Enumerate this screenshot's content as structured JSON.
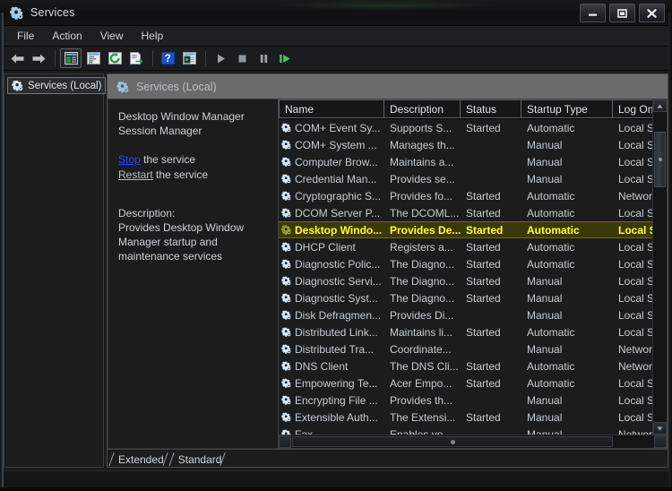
{
  "window": {
    "title": "Services",
    "title_icon": "services-gear-icon",
    "controls": {
      "minimize": "minimize-button",
      "maximize": "maximize-button",
      "close": "close-button"
    }
  },
  "menubar": {
    "items": [
      {
        "label": "File"
      },
      {
        "label": "Action"
      },
      {
        "label": "View"
      },
      {
        "label": "Help"
      }
    ]
  },
  "toolbar": {
    "items": [
      {
        "name": "back-icon"
      },
      {
        "name": "forward-icon"
      },
      {
        "name": "separator"
      },
      {
        "name": "show-hide-console-tree-icon"
      },
      {
        "name": "properties-icon"
      },
      {
        "name": "refresh-icon"
      },
      {
        "name": "export-list-icon"
      },
      {
        "name": "separator"
      },
      {
        "name": "help-icon"
      },
      {
        "name": "show-hide-action-pane-icon"
      },
      {
        "name": "separator"
      },
      {
        "name": "start-service-icon"
      },
      {
        "name": "stop-service-icon"
      },
      {
        "name": "pause-service-icon"
      },
      {
        "name": "restart-service-icon"
      }
    ]
  },
  "tree": {
    "root": {
      "label": "Services (Local)",
      "icon": "services-gear-icon",
      "selected": true
    }
  },
  "pane": {
    "header": {
      "label": "Services (Local)",
      "icon": "services-gear-icon"
    }
  },
  "details": {
    "service_name_line1": "Desktop Window Manager",
    "service_name_line2": "Session Manager",
    "actions": [
      {
        "link": "Stop",
        "suffix": " the service",
        "style": "primary"
      },
      {
        "link": "Restart",
        "suffix": " the service",
        "style": "secondary"
      }
    ],
    "description_label": "Description:",
    "description_lines": [
      "Provides Desktop Window",
      "Manager startup and",
      "maintenance services"
    ]
  },
  "list": {
    "columns": [
      {
        "label": "Name"
      },
      {
        "label": "Description"
      },
      {
        "label": "Status"
      },
      {
        "label": "Startup Type"
      },
      {
        "label": "Log On A"
      }
    ],
    "rows": [
      {
        "name": "COM+ Event Sy...",
        "description": "Supports S...",
        "status": "Started",
        "startup": "Automatic",
        "logon": "Local Ser",
        "selected": false
      },
      {
        "name": "COM+ System ...",
        "description": "Manages th...",
        "status": "",
        "startup": "Manual",
        "logon": "Local Sys",
        "selected": false
      },
      {
        "name": "Computer Brow...",
        "description": "Maintains a...",
        "status": "",
        "startup": "Manual",
        "logon": "Local Sys",
        "selected": false
      },
      {
        "name": "Credential Man...",
        "description": "Provides se...",
        "status": "",
        "startup": "Manual",
        "logon": "Local Sys",
        "selected": false
      },
      {
        "name": "Cryptographic S...",
        "description": "Provides fo...",
        "status": "Started",
        "startup": "Automatic",
        "logon": "Network",
        "selected": false
      },
      {
        "name": "DCOM Server P...",
        "description": "The DCOML...",
        "status": "Started",
        "startup": "Automatic",
        "logon": "Local Sys",
        "selected": false
      },
      {
        "name": "Desktop Windo...",
        "description": "Provides De...",
        "status": "Started",
        "startup": "Automatic",
        "logon": "Local Sys",
        "selected": true
      },
      {
        "name": "DHCP Client",
        "description": "Registers a...",
        "status": "Started",
        "startup": "Automatic",
        "logon": "Local Ser",
        "selected": false
      },
      {
        "name": "Diagnostic Polic...",
        "description": "The Diagno...",
        "status": "Started",
        "startup": "Automatic",
        "logon": "Local Ser",
        "selected": false
      },
      {
        "name": "Diagnostic Servi...",
        "description": "The Diagno...",
        "status": "Started",
        "startup": "Manual",
        "logon": "Local Ser",
        "selected": false
      },
      {
        "name": "Diagnostic Syst...",
        "description": "The Diagno...",
        "status": "Started",
        "startup": "Manual",
        "logon": "Local Sys",
        "selected": false
      },
      {
        "name": "Disk Defragmen...",
        "description": "Provides Di...",
        "status": "",
        "startup": "Manual",
        "logon": "Local Sys",
        "selected": false
      },
      {
        "name": "Distributed Link...",
        "description": "Maintains li...",
        "status": "Started",
        "startup": "Automatic",
        "logon": "Local Sys",
        "selected": false
      },
      {
        "name": "Distributed Tra...",
        "description": "Coordinate...",
        "status": "",
        "startup": "Manual",
        "logon": "Network",
        "selected": false
      },
      {
        "name": "DNS Client",
        "description": "The DNS Cli...",
        "status": "Started",
        "startup": "Automatic",
        "logon": "Network",
        "selected": false
      },
      {
        "name": "Empowering Te...",
        "description": "Acer Empo...",
        "status": "Started",
        "startup": "Automatic",
        "logon": "Local Sys",
        "selected": false
      },
      {
        "name": "Encrypting File ...",
        "description": "Provides th...",
        "status": "",
        "startup": "Manual",
        "logon": "Local Sys",
        "selected": false
      },
      {
        "name": "Extensible Auth...",
        "description": "The Extensi...",
        "status": "Started",
        "startup": "Manual",
        "logon": "Local Sys",
        "selected": false
      },
      {
        "name": "Fax",
        "description": "Enables yo",
        "status": "",
        "startup": "Manual",
        "logon": "Network",
        "selected": false
      }
    ]
  },
  "tabs": {
    "items": [
      {
        "label": "Extended",
        "active": false
      },
      {
        "label": "Standard",
        "active": true
      }
    ]
  },
  "colors": {
    "selection_text": "#ffff2e",
    "selection_bg": "#3b3a06",
    "link_primary": "#2b44ff",
    "link_secondary": "#b7bcc1",
    "window_bg": "#1b1b1b",
    "pane_header_bg": "#6b6b6b"
  }
}
